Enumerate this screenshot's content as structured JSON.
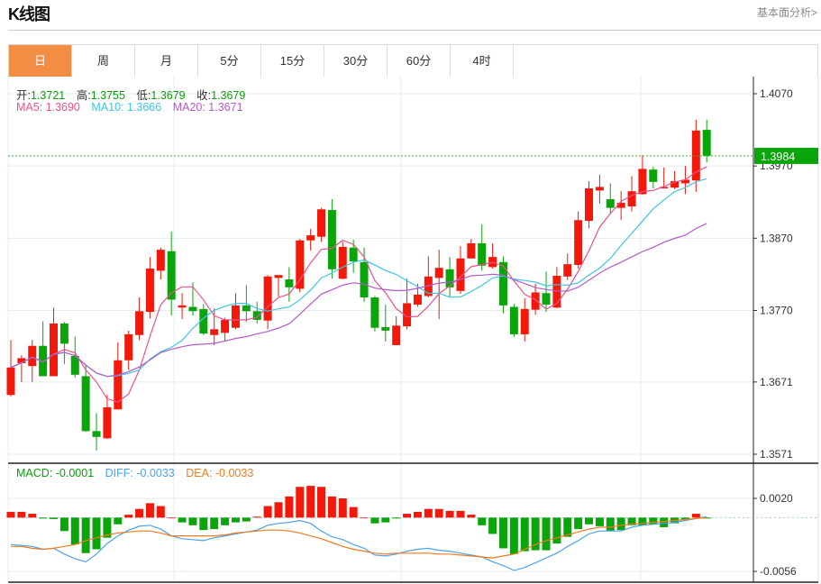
{
  "header": {
    "title": "K线图",
    "link": "基本面分析>"
  },
  "tabs": [
    {
      "label": "日",
      "active": true
    },
    {
      "label": "周"
    },
    {
      "label": "月"
    },
    {
      "label": "5分"
    },
    {
      "label": "15分"
    },
    {
      "label": "30分"
    },
    {
      "label": "60分"
    },
    {
      "label": "4时"
    }
  ],
  "ohlc_info": {
    "open_label": "开:",
    "open": "1.3721",
    "high_label": "高:",
    "high": "1.3755",
    "low_label": "低:",
    "low": "1.3679",
    "close_label": "收:",
    "close": "1.3679"
  },
  "ma_info": {
    "ma5": "MA5: 1.3690",
    "ma10": "MA10: 1.3666",
    "ma20": "MA20: 1.3671"
  },
  "macd_info": {
    "macd": "MACD: -0.0001",
    "diff": "DIFF: -0.0033",
    "dea": "DEA: -0.0033"
  },
  "colors": {
    "up": "#f2190b",
    "down": "#0aa50a",
    "ma5": "#f0508a",
    "ma10": "#3cc6e2",
    "ma20": "#b45ac8",
    "diff": "#4aa3f0",
    "dea": "#f07a1e",
    "active_tab": "#f28d43",
    "price_tag": "#0aa50a"
  },
  "chart_data": [
    {
      "type": "candlestick",
      "y_ticks": [
        "1.4070",
        "1.3970",
        "1.3870",
        "1.3770",
        "1.3671",
        "1.3571"
      ],
      "ylim": [
        1.3571,
        1.407
      ],
      "current_price": "1.3984",
      "ma_periods": [
        5,
        10,
        20
      ],
      "candles": [
        [
          1.3653,
          1.3729,
          1.3651,
          1.3691
        ],
        [
          1.3697,
          1.3708,
          1.3671,
          1.3704
        ],
        [
          1.3693,
          1.3729,
          1.3671,
          1.3721
        ],
        [
          1.3721,
          1.3755,
          1.3679,
          1.3679
        ],
        [
          1.3679,
          1.3774,
          1.3679,
          1.3752
        ],
        [
          1.3752,
          1.3754,
          1.3696,
          1.3724
        ],
        [
          1.3707,
          1.3734,
          1.3677,
          1.3681
        ],
        [
          1.3679,
          1.3694,
          1.3602,
          1.3603
        ],
        [
          1.3603,
          1.3628,
          1.3576,
          1.3595
        ],
        [
          1.3593,
          1.3653,
          1.3592,
          1.3636
        ],
        [
          1.3633,
          1.3726,
          1.3633,
          1.3701
        ],
        [
          1.3701,
          1.3742,
          1.3688,
          1.3737
        ],
        [
          1.3736,
          1.3788,
          1.3729,
          1.3769
        ],
        [
          1.3768,
          1.3844,
          1.3759,
          1.3828
        ],
        [
          1.3825,
          1.3857,
          1.3813,
          1.3854
        ],
        [
          1.3852,
          1.3879,
          1.3763,
          1.3785
        ],
        [
          1.3774,
          1.3794,
          1.3758,
          1.3777
        ],
        [
          1.3775,
          1.3809,
          1.3763,
          1.3769
        ],
        [
          1.3772,
          1.3779,
          1.3736,
          1.3738
        ],
        [
          1.3736,
          1.3773,
          1.3722,
          1.3744
        ],
        [
          1.3739,
          1.376,
          1.3727,
          1.3757
        ],
        [
          1.3746,
          1.3794,
          1.3744,
          1.3777
        ],
        [
          1.3777,
          1.3805,
          1.3754,
          1.3769
        ],
        [
          1.3769,
          1.3782,
          1.3752,
          1.3757
        ],
        [
          1.3756,
          1.3819,
          1.3744,
          1.3817
        ],
        [
          1.3815,
          1.3819,
          1.3789,
          1.3819
        ],
        [
          1.3813,
          1.383,
          1.3782,
          1.3802
        ],
        [
          1.38,
          1.3869,
          1.3795,
          1.3867
        ],
        [
          1.3867,
          1.3883,
          1.3853,
          1.3874
        ],
        [
          1.3872,
          1.3912,
          1.3865,
          1.391
        ],
        [
          1.3909,
          1.3924,
          1.3814,
          1.3827
        ],
        [
          1.3814,
          1.3865,
          1.3813,
          1.3858
        ],
        [
          1.3857,
          1.3868,
          1.3822,
          1.3838
        ],
        [
          1.3837,
          1.3857,
          1.3782,
          1.3788
        ],
        [
          1.3788,
          1.379,
          1.3741,
          1.3746
        ],
        [
          1.3747,
          1.3778,
          1.3727,
          1.3742
        ],
        [
          1.3722,
          1.3762,
          1.3722,
          1.3749
        ],
        [
          1.3748,
          1.3814,
          1.3744,
          1.378
        ],
        [
          1.3778,
          1.3807,
          1.3775,
          1.3792
        ],
        [
          1.379,
          1.3845,
          1.3788,
          1.3817
        ],
        [
          1.3815,
          1.3854,
          1.3758,
          1.3829
        ],
        [
          1.3827,
          1.3844,
          1.3788,
          1.3802
        ],
        [
          1.3797,
          1.3859,
          1.3793,
          1.3842
        ],
        [
          1.3842,
          1.3869,
          1.3842,
          1.3863
        ],
        [
          1.3863,
          1.3889,
          1.3825,
          1.3832
        ],
        [
          1.383,
          1.3863,
          1.3828,
          1.3844
        ],
        [
          1.3837,
          1.3845,
          1.3766,
          1.3777
        ],
        [
          1.3775,
          1.3779,
          1.3733,
          1.3737
        ],
        [
          1.3737,
          1.3787,
          1.3727,
          1.3772
        ],
        [
          1.3771,
          1.3807,
          1.3764,
          1.3795
        ],
        [
          1.3794,
          1.3824,
          1.3768,
          1.3778
        ],
        [
          1.3774,
          1.383,
          1.3773,
          1.3818
        ],
        [
          1.3817,
          1.3849,
          1.3812,
          1.3834
        ],
        [
          1.3833,
          1.3907,
          1.3828,
          1.3895
        ],
        [
          1.3894,
          1.3949,
          1.3884,
          1.3939
        ],
        [
          1.3936,
          1.3958,
          1.3918,
          1.3941
        ],
        [
          1.3924,
          1.3946,
          1.3903,
          1.3912
        ],
        [
          1.3912,
          1.3935,
          1.3895,
          1.3919
        ],
        [
          1.3914,
          1.3956,
          1.3907,
          1.3935
        ],
        [
          1.3931,
          1.3985,
          1.393,
          1.3966
        ],
        [
          1.3965,
          1.3969,
          1.3939,
          1.3948
        ],
        [
          1.3939,
          1.3968,
          1.3939,
          1.3941
        ],
        [
          1.394,
          1.3963,
          1.3938,
          1.3949
        ],
        [
          1.3946,
          1.397,
          1.3931,
          1.3951
        ],
        [
          1.395,
          1.4034,
          1.3934,
          1.4019
        ],
        [
          1.402,
          1.4034,
          1.3975,
          1.3984
        ]
      ]
    },
    {
      "type": "macd",
      "y_ticks": [
        "0.0020",
        "-0.0056"
      ],
      "ylim": [
        -0.0056,
        0.002
      ],
      "macd": [
        0.0006,
        0.0006,
        0.0004,
        -0.0001,
        -0.00015,
        -0.0014,
        -0.0028,
        -0.0037,
        -0.0033,
        -0.0021,
        -0.0007,
        0.0003,
        0.0009,
        0.0015,
        0.0012,
        0.0,
        -0.0005,
        -0.0008,
        -0.0013,
        -0.0012,
        -0.0008,
        -0.0005,
        -0.0004,
        0.0001,
        0.0012,
        0.0016,
        0.0022,
        0.0032,
        0.0033,
        0.0032,
        0.0022,
        0.002,
        0.0011,
        0.0,
        -0.0006,
        -0.0005,
        -0.0001,
        0.0004,
        0.0006,
        0.0009,
        0.0009,
        0.0007,
        0.0007,
        0.0003,
        -0.0008,
        -0.0017,
        -0.0032,
        -0.0038,
        -0.0035,
        -0.0034,
        -0.0034,
        -0.0027,
        -0.002,
        -0.0012,
        -0.0007,
        -0.0009,
        -0.0014,
        -0.0013,
        -0.0008,
        -0.0008,
        -0.0007,
        -0.001,
        -0.0006,
        -0.0002,
        0.0004,
        -0.0001
      ],
      "diff": [
        -0.0028,
        -0.0029,
        -0.003,
        -0.0033,
        -0.0032,
        -0.0038,
        -0.0043,
        -0.0046,
        -0.0038,
        -0.0027,
        -0.0019,
        -0.0013,
        -0.0009,
        -0.0008,
        -0.0012,
        -0.0019,
        -0.0022,
        -0.0023,
        -0.0024,
        -0.0021,
        -0.0019,
        -0.0017,
        -0.0015,
        -0.0013,
        -0.0008,
        -0.0006,
        -0.0005,
        -0.0003,
        -0.0006,
        -0.0014,
        -0.002,
        -0.0023,
        -0.0028,
        -0.0032,
        -0.0039,
        -0.004,
        -0.0038,
        -0.0035,
        -0.0033,
        -0.0032,
        -0.0034,
        -0.0035,
        -0.0037,
        -0.0039,
        -0.0041,
        -0.0046,
        -0.005,
        -0.0055,
        -0.0052,
        -0.0047,
        -0.0042,
        -0.0037,
        -0.003,
        -0.0024,
        -0.0017,
        -0.0014,
        -0.0014,
        -0.0014,
        -0.001,
        -0.0008,
        -0.0007,
        -0.0006,
        -0.0005,
        -0.0003,
        -0.0001,
        0.0001
      ],
      "dea": [
        -0.003,
        -0.003,
        -0.0032,
        -0.0033,
        -0.0032,
        -0.003,
        -0.0028,
        -0.0024,
        -0.0021,
        -0.0018,
        -0.0016,
        -0.0015,
        -0.0014,
        -0.0014,
        -0.0016,
        -0.0019,
        -0.0019,
        -0.0019,
        -0.0019,
        -0.0019,
        -0.0018,
        -0.0016,
        -0.0015,
        -0.0014,
        -0.0013,
        -0.0013,
        -0.0014,
        -0.0016,
        -0.0019,
        -0.0022,
        -0.0026,
        -0.003,
        -0.0033,
        -0.0035,
        -0.0037,
        -0.0038,
        -0.0037,
        -0.0037,
        -0.0037,
        -0.0037,
        -0.0038,
        -0.0038,
        -0.0039,
        -0.004,
        -0.0041,
        -0.0042,
        -0.004,
        -0.0038,
        -0.0033,
        -0.0028,
        -0.0024,
        -0.0021,
        -0.0018,
        -0.0015,
        -0.0012,
        -0.001,
        -0.001,
        -0.0008,
        -0.0007,
        -0.0006,
        -0.0005,
        -0.0004,
        -0.0003,
        -0.0002,
        -0.0001,
        0.0
      ]
    }
  ]
}
